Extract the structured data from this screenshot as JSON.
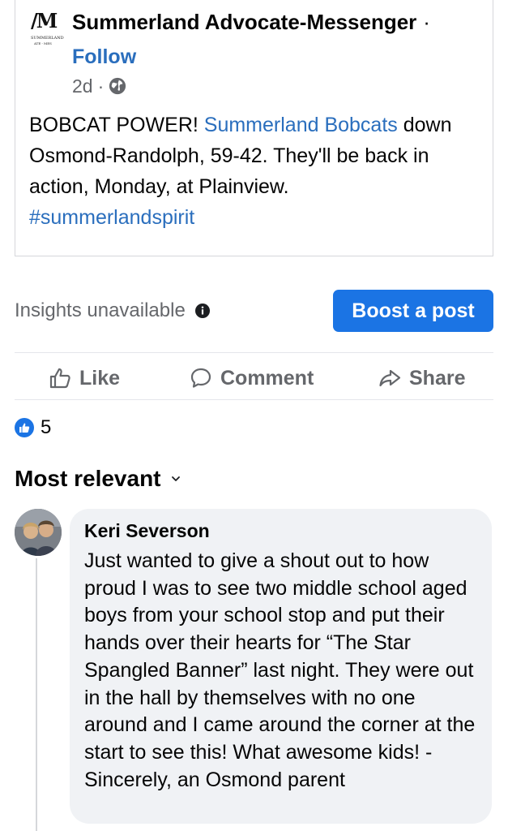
{
  "post": {
    "page_name": "Summerland Advocate-Messenger",
    "name_separator": "·",
    "follow_label": "Follow",
    "time": "2d",
    "time_separator": "·",
    "logo_mark": "/M",
    "logo_text_line1": "SUMMERLAND",
    "logo_text_line2": "ATE - MES",
    "text_part1": "BOBCAT POWER! ",
    "mention": "Summerland Bobcats",
    "text_part2": " down Osmond-Randolph, 59-42. They'll be back in action, Monday, at Plainview.",
    "hashtag": "#summerlandspirit"
  },
  "insights": {
    "label": "Insights unavailable",
    "boost_label": "Boost a post"
  },
  "actions": {
    "like": "Like",
    "comment": "Comment",
    "share": "Share"
  },
  "reactions": {
    "count": "5"
  },
  "comments_filter": {
    "label": "Most relevant"
  },
  "comment": {
    "author": "Keri Severson",
    "text": "Just wanted to give a shout out to how proud I was to see two middle school aged boys from your school stop and put their hands over their hearts for “The Star Spangled Banner” last night. They were out in the hall by themselves with no one around and I came around the corner at the start to see this! What awesome kids!  -Sincerely, an Osmond parent"
  },
  "colors": {
    "link": "#2a6ebd",
    "primary_button": "#1b74e4",
    "muted_text": "#65676b",
    "comment_bubble": "#f0f2f5"
  }
}
